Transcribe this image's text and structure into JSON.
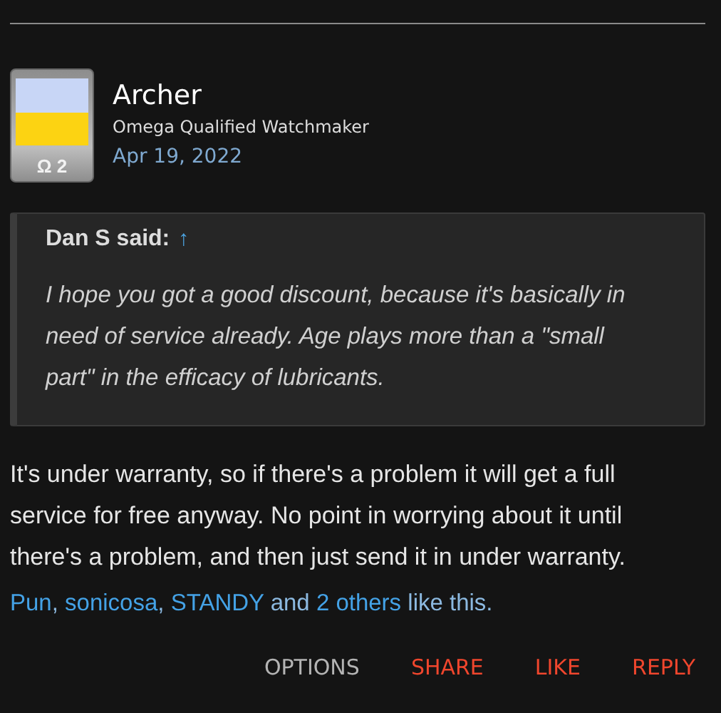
{
  "post": {
    "author": "Archer",
    "user_title": "Omega Qualified Watchmaker",
    "date": "Apr 19, 2022",
    "avatar_badge": "Ω 2"
  },
  "quote": {
    "attribution": "Dan S said:",
    "jump_link": "↑",
    "text": "I hope you got a good discount, because it's basically in need of service already. Age plays more than a \"small part\" in the efficacy of lubricants."
  },
  "body": "It's under warranty, so if there's a problem it will get a full service for free anyway. No point in worrying about it until there's a problem, and then just send it in under warranty.",
  "likes": [
    {
      "text": "Pun",
      "kind": "link"
    },
    {
      "text": ", ",
      "kind": "plain"
    },
    {
      "text": "sonicosa",
      "kind": "link"
    },
    {
      "text": ", ",
      "kind": "plain"
    },
    {
      "text": "STANDY",
      "kind": "link"
    },
    {
      "text": " and ",
      "kind": "plain"
    },
    {
      "text": "2 others",
      "kind": "link"
    },
    {
      "text": " like this.",
      "kind": "plain"
    }
  ],
  "actions": [
    {
      "label": "OPTIONS",
      "color": "#b4b4b4"
    },
    {
      "label": "SHARE",
      "color": "#f0462d"
    },
    {
      "label": "LIKE",
      "color": "#f0462d"
    },
    {
      "label": "REPLY",
      "color": "#f0462d"
    }
  ]
}
